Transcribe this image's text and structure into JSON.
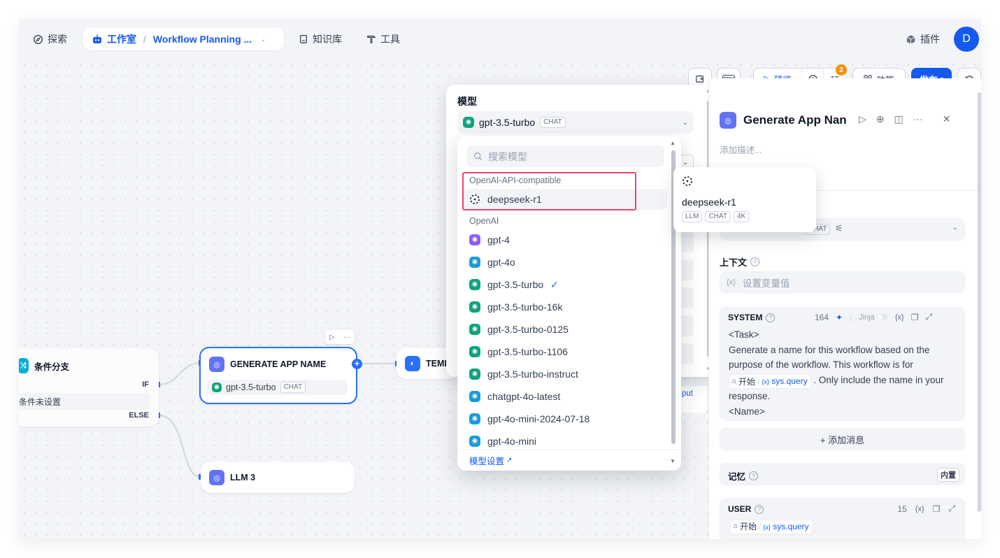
{
  "topbar": {
    "explore": "探索",
    "studio": "工作室",
    "workflow_name": "Workflow Planning ...",
    "knowledge": "知识库",
    "tools": "工具",
    "plugins": "插件",
    "avatar_initial": "D"
  },
  "toolbar": {
    "env_label": "ENV",
    "preview": "预览",
    "checklist_count": "2",
    "features": "功能",
    "publish": "发布"
  },
  "nodes": {
    "if_else": {
      "title": "条件分支",
      "if_label": "IF",
      "condition": "条件未设置",
      "else_label": "ELSE"
    },
    "generate": {
      "title": "GENERATE APP NAME",
      "model": "gpt-3.5-turbo",
      "model_tag": "CHAT"
    },
    "template": {
      "title": "TEMI"
    },
    "llm3": {
      "title": "LLM 3"
    },
    "output_hint": "put"
  },
  "model_panel": {
    "label": "模型",
    "selected_model": "gpt-3.5-turbo",
    "selected_tag": "CHAT"
  },
  "dropdown": {
    "search_placeholder": "搜索模型",
    "groups": [
      {
        "label": "OpenAI-API-compatible",
        "models": [
          "deepseek-r1"
        ]
      },
      {
        "label": "OpenAI",
        "models": [
          "gpt-4",
          "gpt-4o",
          "gpt-3.5-turbo",
          "gpt-3.5-turbo-16k",
          "gpt-3.5-turbo-0125",
          "gpt-3.5-turbo-1106",
          "gpt-3.5-turbo-instruct",
          "chatgpt-4o-latest",
          "gpt-4o-mini-2024-07-18",
          "gpt-4o-mini"
        ]
      }
    ],
    "selected": "gpt-3.5-turbo",
    "footer": "模型设置"
  },
  "tooltip": {
    "model": "deepseek-r1",
    "tags": [
      "LLM",
      "CHAT",
      "4K"
    ]
  },
  "right_panel": {
    "title": "Generate App Nan",
    "description_placeholder": "添加描述...",
    "model_tag": "CHAT",
    "context_label": "上下文",
    "context_placeholder": "设置变量值",
    "system": {
      "label": "SYSTEM",
      "token_count": "164",
      "jinja": "Jinja",
      "line1": "<Task>",
      "line2": "Generate a name for this workflow based on the purpose of the workflow. This workflow is for",
      "var_node": "开始",
      "var_name": "sys.query",
      "line3": ". Only include the name in your response.",
      "line4": "<Name>"
    },
    "add_message": "+ 添加消息",
    "memory_label": "记忆",
    "memory_badge": "内置",
    "user": {
      "label": "USER",
      "token_count": "15",
      "var_node": "开始",
      "var_name": "sys.query"
    }
  },
  "colors": {
    "accent": "#155aef",
    "highlight": "#f04462",
    "gpt_green": "#10a37f",
    "gpt4_purple": "#8e5cf7",
    "gpt4o_blue": "#1b9cd8",
    "badge_orange": "#f79009"
  }
}
